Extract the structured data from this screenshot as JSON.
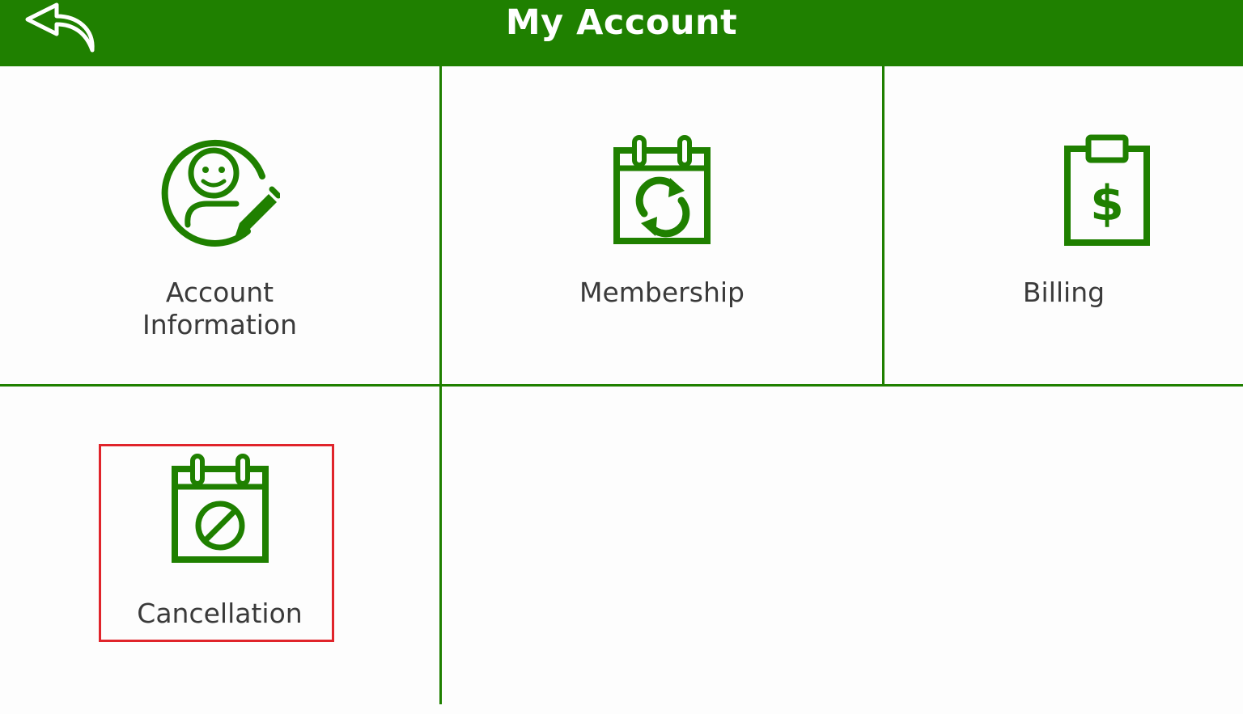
{
  "header": {
    "title": "My Account",
    "back_icon": "back-arrow-icon"
  },
  "colors": {
    "primary": "#1f8000",
    "label": "#3a3a3a",
    "highlight": "#e0242b",
    "background": "#fdfdfd"
  },
  "tiles": [
    {
      "label": "Account\nInformation",
      "icon": "user-edit-icon"
    },
    {
      "label": "Membership",
      "icon": "calendar-refresh-icon"
    },
    {
      "label": "Billing",
      "icon": "clipboard-dollar-icon"
    },
    {
      "label": "Cancellation",
      "icon": "calendar-cancel-icon"
    }
  ]
}
